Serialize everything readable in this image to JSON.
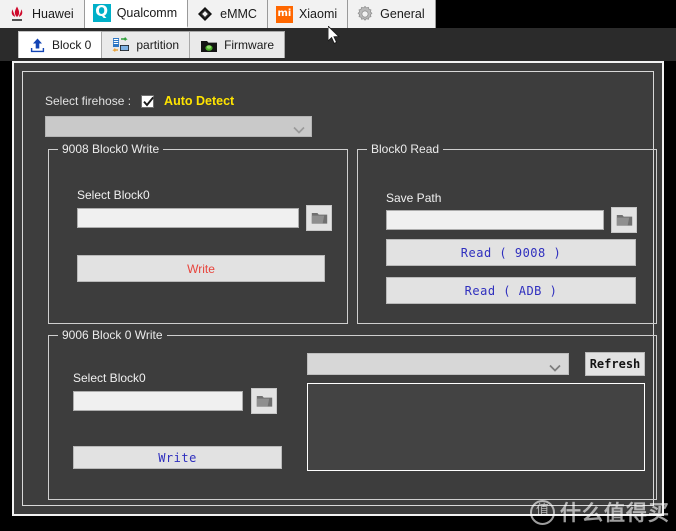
{
  "window": {
    "background": "#000000",
    "panel_background": "#3d3d3d"
  },
  "vendor_tabs": [
    {
      "label": "Huawei",
      "icon": "huawei-logo-icon",
      "active": false
    },
    {
      "label": "Qualcomm",
      "icon": "qualcomm-logo-icon",
      "active": true
    },
    {
      "label": "eMMC",
      "icon": "emmc-chip-icon",
      "active": false
    },
    {
      "label": "Xiaomi",
      "icon": "xiaomi-logo-icon",
      "active": false
    },
    {
      "label": "General",
      "icon": "gear-icon",
      "active": false
    }
  ],
  "sub_tabs": [
    {
      "label": "Block 0",
      "icon": "upload-arrow-icon",
      "active": true
    },
    {
      "label": "partition",
      "icon": "partition-transfer-icon",
      "active": false
    },
    {
      "label": "Firmware",
      "icon": "firmware-folder-icon",
      "active": false
    }
  ],
  "firehose": {
    "label": "Select firehose :",
    "auto_detect_label": "Auto Detect",
    "auto_detect_checked": true,
    "auto_detect_color": "#ffe400",
    "combo_value": "",
    "combo_placeholder": ""
  },
  "group_9008_write": {
    "title": "9008 Block0 Write",
    "field_label": "Select Block0",
    "path_value": "",
    "path_placeholder": "",
    "browse_icon": "folder-icon",
    "write_button": "Write",
    "write_button_color": "#e8443c"
  },
  "group_block0_read": {
    "title": "Block0 Read",
    "field_label": "Save Path",
    "path_value": "",
    "path_placeholder": "",
    "browse_icon": "folder-icon",
    "read_9008_button": "Read ( 9008 )",
    "read_adb_button": "Read ( ADB )",
    "read_button_color": "#2f2fbe"
  },
  "group_9006_write": {
    "title": "9006 Block 0 Write",
    "field_label": "Select Block0",
    "path_value": "",
    "path_placeholder": "",
    "browse_icon": "folder-icon",
    "write_button": "Write",
    "write_button_color": "#2f2fbe",
    "port_combo_value": "",
    "refresh_button": "Refresh",
    "log_list_value": ""
  },
  "watermark": {
    "mark": "值",
    "text": "什么值得买"
  }
}
